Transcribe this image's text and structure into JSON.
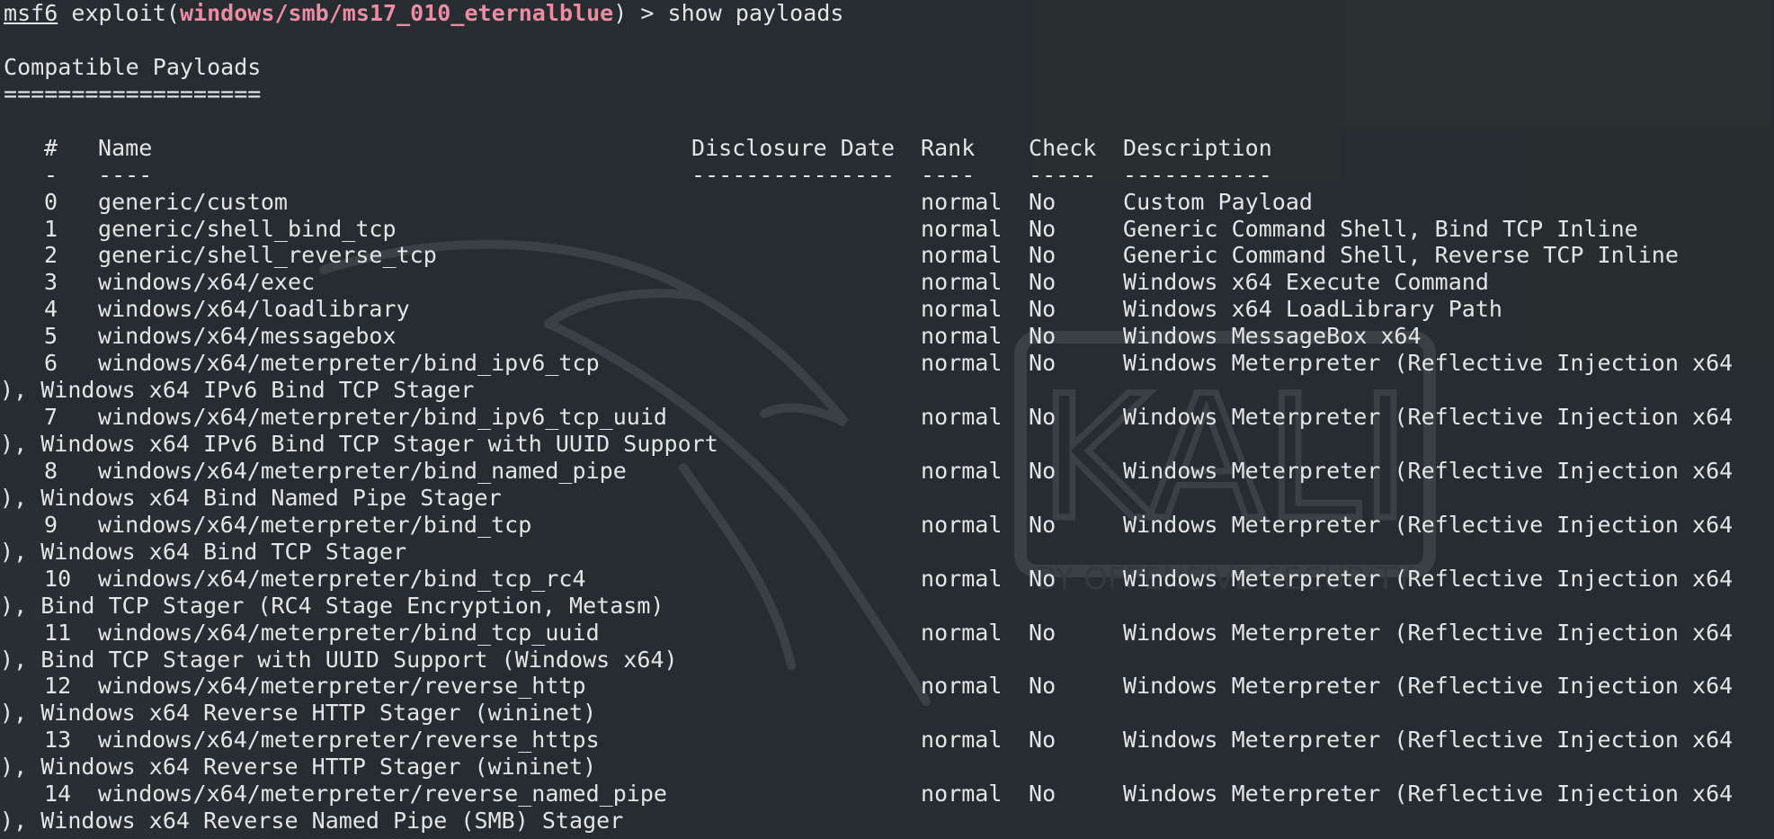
{
  "prompt": {
    "msf": "msf6",
    "exploit_prefix": " exploit(",
    "module": "windows/smb/ms17_010_eternalblue",
    "suffix": ") > ",
    "command": "show payloads"
  },
  "heading": "Compatible Payloads",
  "heading_rule": "===================",
  "columns": {
    "num": "#",
    "name": "Name",
    "date": "Disclosure Date",
    "rank": "Rank",
    "check": "Check",
    "desc": "Description"
  },
  "separators": {
    "num": "-",
    "name": "----",
    "date": "---------------",
    "rank": "----",
    "check": "-----",
    "desc": "-----------"
  },
  "rows": [
    {
      "num": "0",
      "name": "generic/custom",
      "date": "",
      "rank": "normal",
      "check": "No",
      "desc": "Custom Payload",
      "wrap": ""
    },
    {
      "num": "1",
      "name": "generic/shell_bind_tcp",
      "date": "",
      "rank": "normal",
      "check": "No",
      "desc": "Generic Command Shell, Bind TCP Inline",
      "wrap": ""
    },
    {
      "num": "2",
      "name": "generic/shell_reverse_tcp",
      "date": "",
      "rank": "normal",
      "check": "No",
      "desc": "Generic Command Shell, Reverse TCP Inline",
      "wrap": ""
    },
    {
      "num": "3",
      "name": "windows/x64/exec",
      "date": "",
      "rank": "normal",
      "check": "No",
      "desc": "Windows x64 Execute Command",
      "wrap": ""
    },
    {
      "num": "4",
      "name": "windows/x64/loadlibrary",
      "date": "",
      "rank": "normal",
      "check": "No",
      "desc": "Windows x64 LoadLibrary Path",
      "wrap": ""
    },
    {
      "num": "5",
      "name": "windows/x64/messagebox",
      "date": "",
      "rank": "normal",
      "check": "No",
      "desc": "Windows MessageBox x64",
      "wrap": ""
    },
    {
      "num": "6",
      "name": "windows/x64/meterpreter/bind_ipv6_tcp",
      "date": "",
      "rank": "normal",
      "check": "No",
      "desc": "Windows Meterpreter (Reflective Injection x64",
      "wrap": "), Windows x64 IPv6 Bind TCP Stager"
    },
    {
      "num": "7",
      "name": "windows/x64/meterpreter/bind_ipv6_tcp_uuid",
      "date": "",
      "rank": "normal",
      "check": "No",
      "desc": "Windows Meterpreter (Reflective Injection x64",
      "wrap": "), Windows x64 IPv6 Bind TCP Stager with UUID Support"
    },
    {
      "num": "8",
      "name": "windows/x64/meterpreter/bind_named_pipe",
      "date": "",
      "rank": "normal",
      "check": "No",
      "desc": "Windows Meterpreter (Reflective Injection x64",
      "wrap": "), Windows x64 Bind Named Pipe Stager"
    },
    {
      "num": "9",
      "name": "windows/x64/meterpreter/bind_tcp",
      "date": "",
      "rank": "normal",
      "check": "No",
      "desc": "Windows Meterpreter (Reflective Injection x64",
      "wrap": "), Windows x64 Bind TCP Stager"
    },
    {
      "num": "10",
      "name": "windows/x64/meterpreter/bind_tcp_rc4",
      "date": "",
      "rank": "normal",
      "check": "No",
      "desc": "Windows Meterpreter (Reflective Injection x64",
      "wrap": "), Bind TCP Stager (RC4 Stage Encryption, Metasm)"
    },
    {
      "num": "11",
      "name": "windows/x64/meterpreter/bind_tcp_uuid",
      "date": "",
      "rank": "normal",
      "check": "No",
      "desc": "Windows Meterpreter (Reflective Injection x64",
      "wrap": "), Bind TCP Stager with UUID Support (Windows x64)"
    },
    {
      "num": "12",
      "name": "windows/x64/meterpreter/reverse_http",
      "date": "",
      "rank": "normal",
      "check": "No",
      "desc": "Windows Meterpreter (Reflective Injection x64",
      "wrap": "), Windows x64 Reverse HTTP Stager (wininet)"
    },
    {
      "num": "13",
      "name": "windows/x64/meterpreter/reverse_https",
      "date": "",
      "rank": "normal",
      "check": "No",
      "desc": "Windows Meterpreter (Reflective Injection x64",
      "wrap": "), Windows x64 Reverse HTTP Stager (wininet)"
    },
    {
      "num": "14",
      "name": "windows/x64/meterpreter/reverse_named_pipe",
      "date": "",
      "rank": "normal",
      "check": "No",
      "desc": "Windows Meterpreter (Reflective Injection x64",
      "wrap": "), Windows x64 Reverse Named Pipe (SMB) Stager"
    }
  ],
  "wallpaper": {
    "logo_text": "KALI",
    "tagline": "BY OFFENSIVE SECURITY",
    "icon": "kali-dragon-icon"
  },
  "colors": {
    "background": "#262c2f",
    "text": "#e3e6e8",
    "module": "#ed8da4",
    "watermark": "#3a4043"
  }
}
